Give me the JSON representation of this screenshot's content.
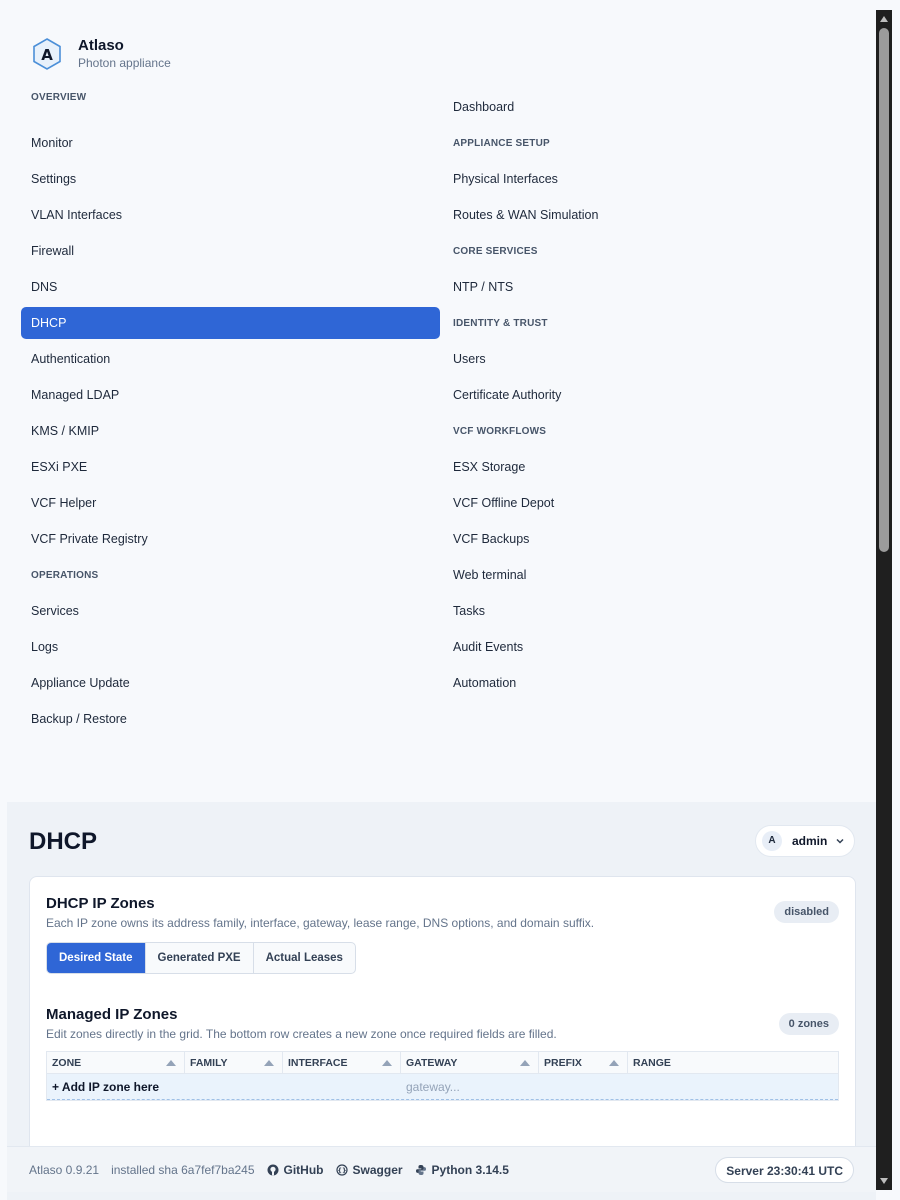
{
  "brand": {
    "name": "Atlaso",
    "subtitle": "Photon appliance"
  },
  "nav": {
    "sections": {
      "overview": "OVERVIEW",
      "appliance_setup": "APPLIANCE SETUP",
      "core_services": "CORE SERVICES",
      "identity_trust": "IDENTITY & TRUST",
      "vcf_workflows": "VCF WORKFLOWS",
      "operations": "OPERATIONS"
    },
    "items": {
      "dashboard": "Dashboard",
      "monitor": "Monitor",
      "settings": "Settings",
      "physical_interfaces": "Physical Interfaces",
      "vlan_interfaces": "VLAN Interfaces",
      "routes_wan": "Routes & WAN Simulation",
      "firewall": "Firewall",
      "dns": "DNS",
      "ntp_nts": "NTP / NTS",
      "dhcp": "DHCP",
      "authentication": "Authentication",
      "users": "Users",
      "managed_ldap": "Managed LDAP",
      "certificate_authority": "Certificate Authority",
      "kms_kmip": "KMS / KMIP",
      "esxi_pxe": "ESXi PXE",
      "esx_storage": "ESX Storage",
      "vcf_helper": "VCF Helper",
      "vcf_offline_depot": "VCF Offline Depot",
      "vcf_private_registry": "VCF Private Registry",
      "vcf_backups": "VCF Backups",
      "web_terminal": "Web terminal",
      "services": "Services",
      "tasks": "Tasks",
      "logs": "Logs",
      "audit_events": "Audit Events",
      "appliance_update": "Appliance Update",
      "automation": "Automation",
      "backup_restore": "Backup / Restore"
    },
    "active": "dhcp"
  },
  "header": {
    "title": "DHCP",
    "user_initial": "A",
    "user_name": "admin"
  },
  "card": {
    "title": "DHCP IP Zones",
    "description": "Each IP zone owns its address family, interface, gateway, lease range, DNS options, and domain suffix.",
    "status": "disabled",
    "tabs": [
      "Desired State",
      "Generated PXE",
      "Actual Leases"
    ],
    "active_tab": "Desired State",
    "zones_title": "Managed IP Zones",
    "zones_description": "Edit zones directly in the grid. The bottom row creates a new zone once required fields are filled.",
    "zones_count": "0 zones",
    "columns": [
      "ZONE",
      "FAMILY",
      "INTERFACE",
      "GATEWAY",
      "PREFIX",
      "RANGE"
    ],
    "add_row_label": "+ Add IP zone here",
    "gateway_placeholder": "gateway..."
  },
  "footer": {
    "version": "Atlaso 0.9.21",
    "sha": "installed sha 6a7fef7ba245",
    "github": "GitHub",
    "swagger": "Swagger",
    "python": "Python 3.14.5",
    "server_time": "Server 23:30:41 UTC"
  },
  "colors": {
    "accent": "#2f66d6",
    "scrollbar": "#1f1f1f"
  }
}
